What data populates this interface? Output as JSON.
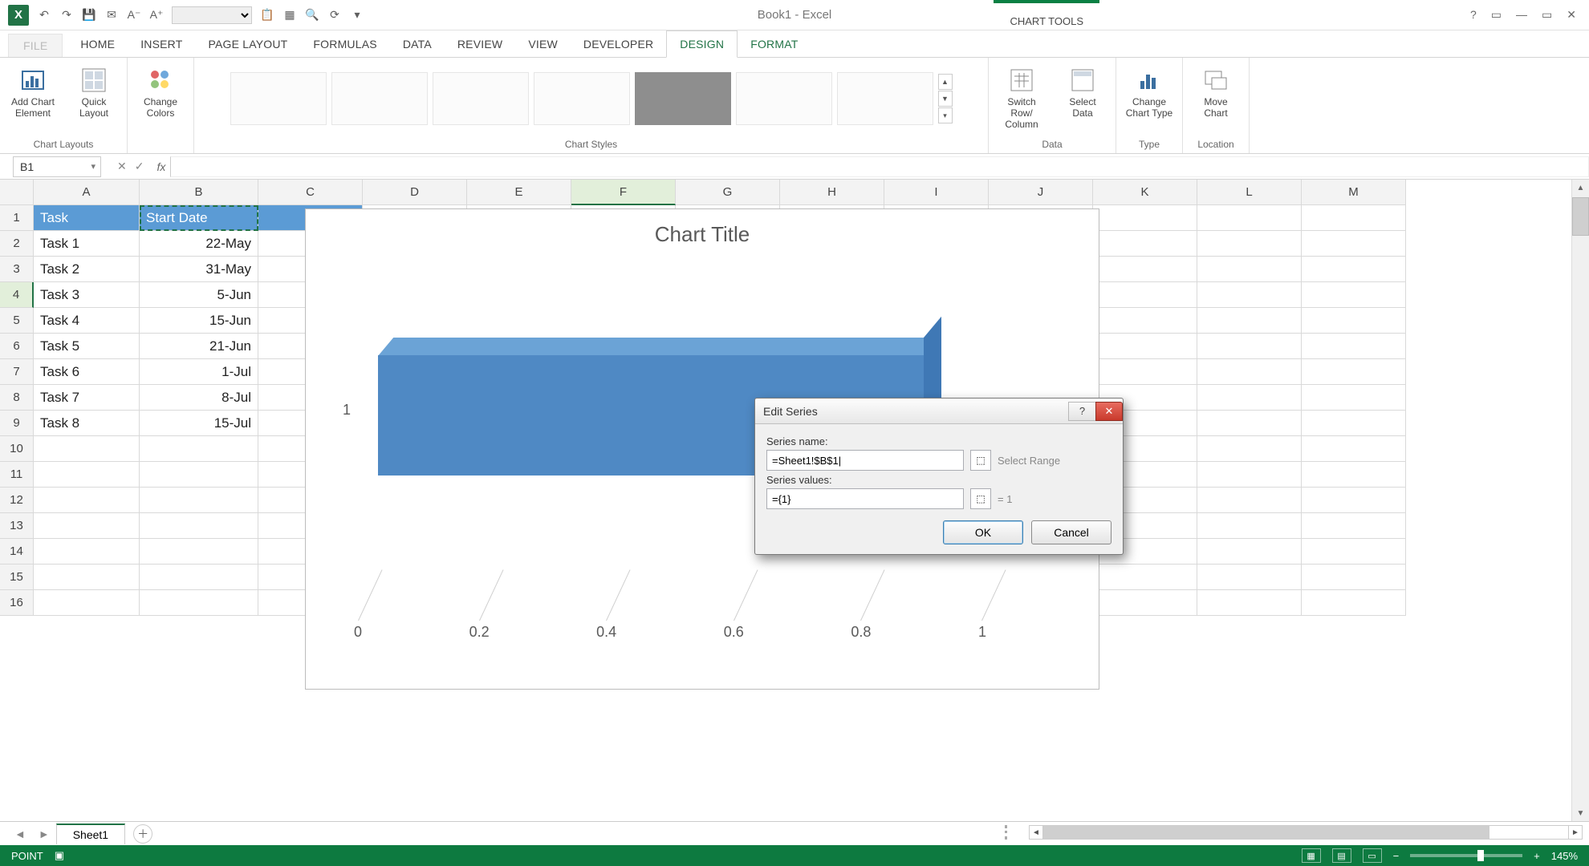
{
  "app": {
    "title": "Book1 - Excel",
    "chart_tools_label": "CHART TOOLS"
  },
  "window_buttons": {
    "help": "?",
    "ribbon_opts": "▭",
    "minimize": "—",
    "restore": "▭",
    "close": "✕"
  },
  "tabs": {
    "file": "FILE",
    "home": "HOME",
    "insert": "INSERT",
    "page_layout": "PAGE LAYOUT",
    "formulas": "FORMULAS",
    "data": "DATA",
    "review": "REVIEW",
    "view": "VIEW",
    "developer": "DEVELOPER",
    "design": "DESIGN",
    "format": "FORMAT"
  },
  "ribbon": {
    "chart_layouts": {
      "label": "Chart Layouts",
      "add_element": "Add Chart Element",
      "quick_layout": "Quick Layout"
    },
    "change_colors": "Change Colors",
    "chart_styles": {
      "label": "Chart Styles"
    },
    "data_group": {
      "label": "Data",
      "switch": "Switch Row/ Column",
      "select": "Select Data"
    },
    "type_group": {
      "label": "Type",
      "change_chart_type": "Change Chart Type"
    },
    "location_group": {
      "label": "Location",
      "move_chart": "Move Chart"
    }
  },
  "namebox": "B1",
  "columns": [
    "A",
    "B",
    "C",
    "D",
    "E",
    "F",
    "G",
    "H",
    "I",
    "J",
    "K",
    "L",
    "M"
  ],
  "active_column": "F",
  "active_row": 4,
  "headers": {
    "A1": "Task",
    "B1": "Start Date"
  },
  "cells": {
    "tasks": [
      "Task 1",
      "Task 2",
      "Task 3",
      "Task 4",
      "Task 5",
      "Task 6",
      "Task 7",
      "Task 8"
    ],
    "dates": [
      "22-May",
      "31-May",
      "5-Jun",
      "15-Jun",
      "21-Jun",
      "1-Jul",
      "8-Jul",
      "15-Jul"
    ]
  },
  "chart": {
    "title": "Chart Title",
    "y_tick": "1",
    "x_ticks": [
      "0",
      "0.2",
      "0.4",
      "0.6",
      "0.8",
      "1"
    ]
  },
  "chart_data": {
    "type": "bar",
    "orientation": "horizontal",
    "title": "Chart Title",
    "categories": [
      "1"
    ],
    "series": [
      {
        "name": "",
        "values": [
          1
        ]
      }
    ],
    "xlim": [
      0,
      1
    ],
    "x_ticks": [
      0,
      0.2,
      0.4,
      0.6,
      0.8,
      1
    ],
    "xlabel": "",
    "ylabel": ""
  },
  "dialog": {
    "title": "Edit Series",
    "series_name_label": "Series name:",
    "series_name_value": "=Sheet1!$B$1|",
    "series_name_hint": "Select Range",
    "series_values_label": "Series values:",
    "series_values_value": "={1}",
    "series_values_hint": "= 1",
    "ok": "OK",
    "cancel": "Cancel"
  },
  "sheet": {
    "name": "Sheet1"
  },
  "status": {
    "mode": "POINT",
    "zoom": "145%"
  }
}
